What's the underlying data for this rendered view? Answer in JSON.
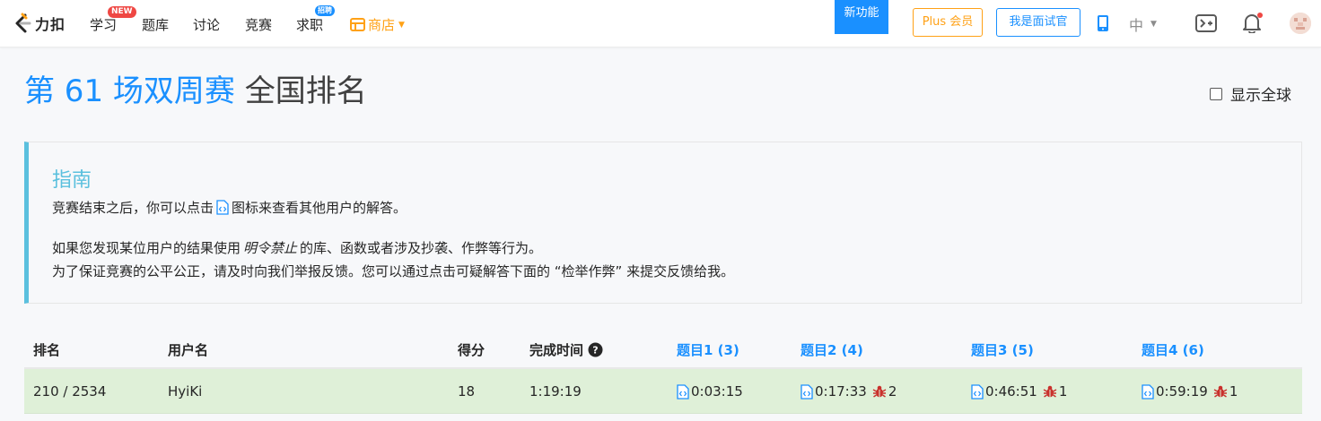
{
  "nav": {
    "logo_text": "力扣",
    "items": [
      "学习",
      "题库",
      "讨论",
      "竞赛",
      "求职"
    ],
    "badge_new": "NEW",
    "badge_hire": "招聘",
    "store_label": "商店",
    "new_feature_label": "新功能",
    "plus_label": "Plus 会员",
    "interviewer_label": "我是面试官",
    "lang_label": "中",
    "icons": [
      "phone-icon",
      "chevron-down-icon",
      "playground-icon",
      "bell-icon",
      "avatar"
    ],
    "colors": {
      "accent": "#1a90ff",
      "orange": "#ffa116",
      "red": "#ef4743"
    }
  },
  "page": {
    "title_blue": "第 61 场双周赛",
    "title_dark": "全国排名",
    "show_global_label": "显示全球",
    "show_global_checked": false
  },
  "guide": {
    "title": "指南",
    "line1_before": "竞赛结束之后，你可以点击",
    "line1_after": "图标来查看其他用户的解答。",
    "line2_before": "如果您发现某位用户的结果使用",
    "line2_em": "明令禁止",
    "line2_after": "的库、函数或者涉及抄袭、作弊等行为。",
    "line3": "为了保证竞赛的公平公正，请及时向我们举报反馈。您可以通过点击可疑解答下面的 “检举作弊” 来提交反馈给我。",
    "accent": "#5bc0de"
  },
  "table": {
    "headers": {
      "rank": "排名",
      "user": "用户名",
      "score": "得分",
      "time": "完成时间",
      "q1": "题目1 (3)",
      "q2": "题目2 (4)",
      "q3": "题目3 (5)",
      "q4": "题目4 (6)"
    },
    "row": {
      "rank": "210 / 2534",
      "user": "HyiKi",
      "score": "18",
      "time": "1:19:19",
      "q1_time": "0:03:15",
      "q2_time": "0:17:33",
      "q2_penalty": "2",
      "q3_time": "0:46:51",
      "q3_penalty": "1",
      "q4_time": "0:59:19",
      "q4_penalty": "1",
      "highlight": "#dff0d8"
    }
  }
}
